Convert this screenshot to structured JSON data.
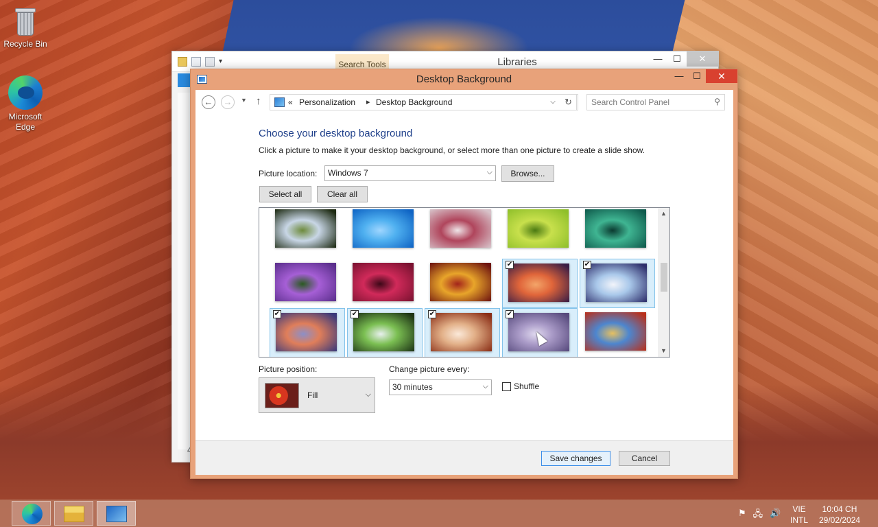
{
  "desktop": {
    "icons": [
      {
        "label": "Recycle Bin",
        "icon": "recycle-bin-icon"
      },
      {
        "label": "Microsoft Edge",
        "icon": "edge-icon"
      }
    ]
  },
  "libraries_window": {
    "title": "Libraries",
    "ribbon_tab": "Search Tools",
    "caption": {
      "minimize": "—",
      "maximize": "☐",
      "close": "✕"
    },
    "status_text": "4"
  },
  "dialog": {
    "title": "Desktop Background",
    "caption": {
      "minimize": "—",
      "maximize": "☐",
      "close": "✕"
    },
    "nav": {
      "back": "←",
      "forward": "→",
      "recent": "▼",
      "up": "↑"
    },
    "address": {
      "overflow": "«",
      "crumbs": [
        "Personalization",
        "Desktop Background"
      ],
      "separator": "▸",
      "dropdown": "⌵",
      "refresh": "↻"
    },
    "search": {
      "placeholder": "Search Control Panel",
      "icon": "⚲"
    },
    "heading": "Choose your desktop background",
    "instructions": "Click a picture to make it your desktop background, or select more than one picture to create a slide show.",
    "picture_location_label": "Picture location:",
    "picture_location_value": "Windows 7",
    "dropdown_arrow": "⌵",
    "browse_label": "Browse...",
    "select_all_label": "Select all",
    "clear_all_label": "Clear all",
    "checkmark": "✔",
    "scroll": {
      "up": "▲",
      "down": "▼"
    },
    "thumbnails": [
      {
        "name": "hydrangea",
        "selected": false,
        "colors": [
          "#1d2a12",
          "#c8d6e6",
          "#6d8a3b"
        ]
      },
      {
        "name": "windows-logo",
        "selected": false,
        "colors": [
          "#0f64c4",
          "#4fb0f0",
          "#9fd6ff"
        ]
      },
      {
        "name": "dandelion",
        "selected": false,
        "colors": [
          "#d7c2c9",
          "#b0455c",
          "#efe5e8"
        ]
      },
      {
        "name": "green-leaves",
        "selected": false,
        "colors": [
          "#8fbf2a",
          "#c8e04c",
          "#4b7a12"
        ]
      },
      {
        "name": "teal-plant",
        "selected": false,
        "colors": [
          "#0f5a4c",
          "#3fb592",
          "#0a3a30"
        ]
      },
      {
        "name": "purple-thistle",
        "selected": false,
        "colors": [
          "#5b2f8c",
          "#a65fd6",
          "#2a5a20"
        ]
      },
      {
        "name": "pink-dahlia",
        "selected": false,
        "colors": [
          "#7a1230",
          "#d12a5a",
          "#3d0818"
        ]
      },
      {
        "name": "autumn-leaves",
        "selected": false,
        "colors": [
          "#6e1410",
          "#e8a52a",
          "#a3241b"
        ]
      },
      {
        "name": "red-canyon",
        "selected": true,
        "colors": [
          "#3a1d45",
          "#e0653a",
          "#f3a569"
        ]
      },
      {
        "name": "icy-fjord",
        "selected": true,
        "colors": [
          "#2d2e6b",
          "#a9c8ea",
          "#f2f4fa"
        ]
      },
      {
        "name": "coast-sunset",
        "selected": true,
        "colors": [
          "#3b3a7a",
          "#e07e5a",
          "#8c8fc7"
        ]
      },
      {
        "name": "waterfall",
        "selected": true,
        "colors": [
          "#1e3516",
          "#7bbf52",
          "#e8f0ee"
        ]
      },
      {
        "name": "stone-arch",
        "selected": true,
        "colors": [
          "#8a2e16",
          "#e2b088",
          "#fbe9d9"
        ]
      },
      {
        "name": "lavender-field",
        "selected": true,
        "colors": [
          "#574a7d",
          "#a99ac7",
          "#e0d9ef"
        ]
      },
      {
        "name": "space-needle",
        "selected": false,
        "colors": [
          "#b8301b",
          "#4d86cf",
          "#e6c060"
        ]
      }
    ],
    "picture_position_label": "Picture position:",
    "picture_position_value": "Fill",
    "change_every_label": "Change picture every:",
    "change_every_value": "30 minutes",
    "shuffle_label": "Shuffle",
    "save_label": "Save changes",
    "cancel_label": "Cancel"
  },
  "taskbar": {
    "apps": [
      "Microsoft Edge",
      "File Explorer",
      "Control Panel"
    ],
    "tray_icons": [
      "⚑",
      "🖧",
      "🔊"
    ],
    "language": [
      "VIE",
      "INTL"
    ],
    "time": "10:04 CH",
    "date": "29/02/2024"
  }
}
